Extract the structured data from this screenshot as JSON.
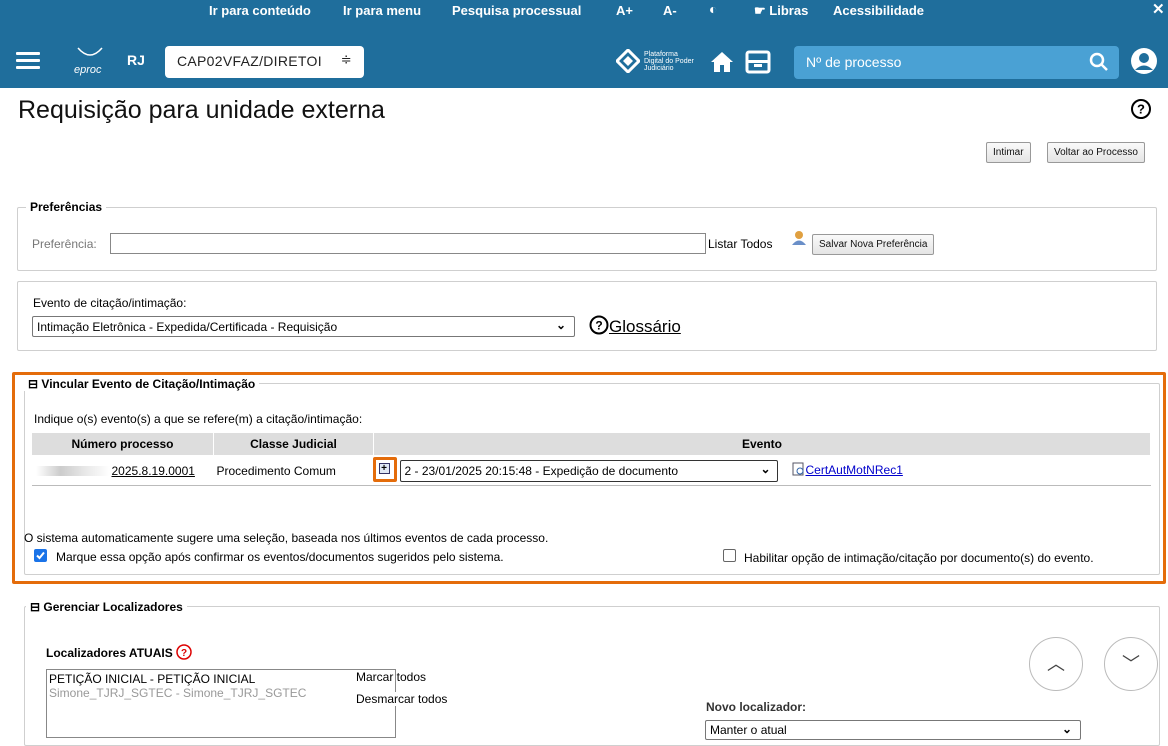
{
  "accessibility": {
    "skip_content": "Ir para conteúdo",
    "skip_menu": "Ir para menu",
    "search": "Pesquisa processual",
    "font_up": "A+",
    "font_down": "A-",
    "contrast_icon": "◐",
    "libras": "Libras",
    "accessibility": "Acessibilidade",
    "close": "✕"
  },
  "header": {
    "logo_text": "eproc",
    "state": "RJ",
    "unit": "CAP02VFAZ/DIRETOI",
    "pdpj_text": "Plataforma Digital do Poder Judiciário",
    "process_placeholder": "Nº de processo"
  },
  "page": {
    "title": "Requisição para unidade externa",
    "btn_intimar": "Intimar",
    "btn_voltar": "Voltar ao Processo"
  },
  "preferences": {
    "legend": "Preferências",
    "label": "Preferência:",
    "list_all": "Listar Todos",
    "save_btn": "Salvar Nova Preferência"
  },
  "event": {
    "label": "Evento de citação/intimação:",
    "selected": "Intimação Eletrônica - Expedida/Certificada - Requisição",
    "glossary": "Glossário"
  },
  "vincular": {
    "legend": "Vincular Evento de Citação/Intimação",
    "instructions": "Indique o(s) evento(s) a que se refere(m) a citação/intimação:",
    "columns": [
      "Número processo",
      "Classe Judicial",
      "Evento"
    ],
    "row": {
      "process_number": "2025.8.19.0001",
      "class": "Procedimento Comum",
      "event": "2 - 23/01/2025 20:15:48 - Expedição de documento",
      "document": "CertAutMotNRec1"
    },
    "auto_note": "O sistema automaticamente sugere uma seleção, baseada nos últimos eventos de cada processo.",
    "confirm_label": "Marque essa opção após confirmar os eventos/documentos sugeridos pelo sistema.",
    "enable_label": "Habilitar opção de intimação/citação por documento(s) do evento."
  },
  "locators": {
    "legend": "Gerenciar Localizadores",
    "current_label": "Localizadores ATUAIS",
    "items": [
      "PETIÇÃO INICIAL - PETIÇÃO INICIAL",
      "Simone_TJRJ_SGTEC - Simone_TJRJ_SGTEC"
    ],
    "mark_all": "Marcar todos",
    "unmark_all": "Desmarcar todos",
    "new_label": "Novo localizador:",
    "new_value": "Manter o atual"
  },
  "colors": {
    "brand": "#1f6e9c",
    "highlight": "#e46c0a",
    "checkbox": "#1a73e8"
  }
}
